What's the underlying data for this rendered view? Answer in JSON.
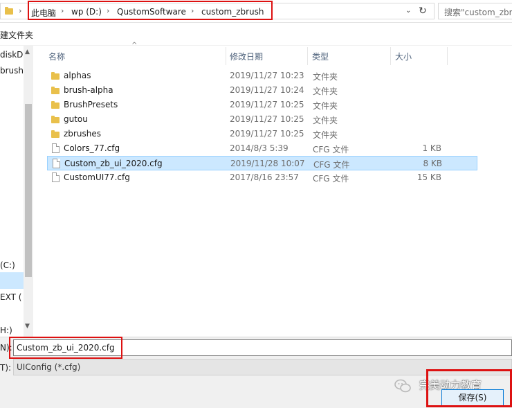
{
  "address_bar": {
    "crumbs": [
      "此电脑",
      "wp (D:)",
      "QustomSoftware",
      "custom_zbrush"
    ],
    "search_placeholder": "搜索\"custom_zbrush\""
  },
  "toolbar": {
    "new_folder_label": "建文件夹"
  },
  "nav_pane": {
    "items": [
      {
        "label": "diskD"
      },
      {
        "label": "brush"
      },
      {
        "label": "(C:)"
      },
      {
        "label": "EXT ("
      },
      {
        "label": "H:)"
      }
    ]
  },
  "columns": {
    "name": "名称",
    "date": "修改日期",
    "type": "类型",
    "size": "大小"
  },
  "files": [
    {
      "name": "alphas",
      "date": "2019/11/27 10:23",
      "type": "文件夹",
      "size": "",
      "kind": "folder"
    },
    {
      "name": "brush-alpha",
      "date": "2019/11/27 10:24",
      "type": "文件夹",
      "size": "",
      "kind": "folder"
    },
    {
      "name": "BrushPresets",
      "date": "2019/11/27 10:25",
      "type": "文件夹",
      "size": "",
      "kind": "folder"
    },
    {
      "name": "gutou",
      "date": "2019/11/27 10:25",
      "type": "文件夹",
      "size": "",
      "kind": "folder"
    },
    {
      "name": "zbrushes",
      "date": "2019/11/27 10:25",
      "type": "文件夹",
      "size": "",
      "kind": "folder"
    },
    {
      "name": "Colors_77.cfg",
      "date": "2014/8/3 5:39",
      "type": "CFG 文件",
      "size": "1 KB",
      "kind": "file"
    },
    {
      "name": "Custom_zb_ui_2020.cfg",
      "date": "2019/11/28 10:07",
      "type": "CFG 文件",
      "size": "8 KB",
      "kind": "file",
      "selected": true
    },
    {
      "name": "CustomUI77.cfg",
      "date": "2017/8/16 23:57",
      "type": "CFG 文件",
      "size": "15 KB",
      "kind": "file"
    }
  ],
  "filename": {
    "label": "N):",
    "value": "Custom_zb_ui_2020.cfg"
  },
  "filetype": {
    "label": "T):",
    "value": "UIConfig (*.cfg)"
  },
  "save_button": {
    "label": "保存(S)"
  },
  "watermark": {
    "text": "完美动力教育"
  },
  "colors": {
    "highlight_red": "#dd1111",
    "selection_blue": "#cce8ff",
    "folder_yellow": "#e9c04b"
  }
}
